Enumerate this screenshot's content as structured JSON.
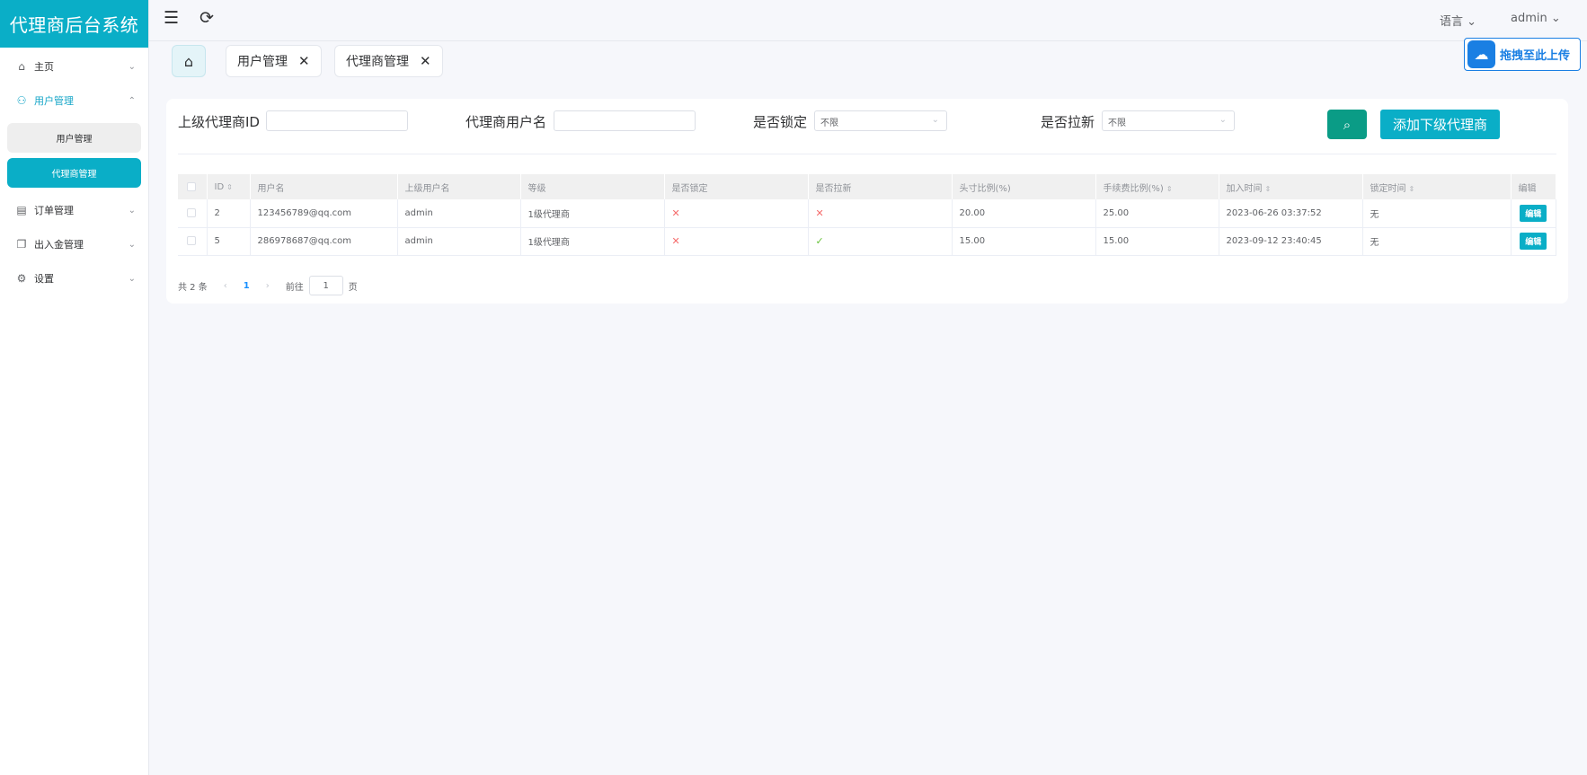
{
  "app": {
    "title": "代理商后台系统"
  },
  "sidebar": {
    "items": [
      {
        "label": "主页",
        "icon": "home-icon",
        "glyph": "⌂",
        "chev": "⌄"
      },
      {
        "label": "用户管理",
        "icon": "user-icon",
        "glyph": "⚇",
        "chev": "⌃"
      },
      {
        "label": "订单管理",
        "icon": "document-icon",
        "glyph": "▤",
        "chev": "⌄"
      },
      {
        "label": "出入金管理",
        "icon": "copy-icon",
        "glyph": "❐",
        "chev": "⌄"
      },
      {
        "label": "设置",
        "icon": "gear-icon",
        "glyph": "⚙",
        "chev": "⌄"
      }
    ],
    "sub_items": [
      "用户管理",
      "代理商管理"
    ]
  },
  "header": {
    "language": "语言 ⌄",
    "user": "admin ⌄",
    "menu_glyph": "☰",
    "refresh_glyph": "⟳"
  },
  "tabs": [
    {
      "label": "用户管理",
      "close": "✕"
    },
    {
      "label": "代理商管理",
      "close": "✕"
    }
  ],
  "home_glyph": "⌂",
  "upload": {
    "label": "拖拽至此上传",
    "glyph": "☁"
  },
  "filters": {
    "parent_id_label": "上级代理商ID",
    "username_label": "代理商用户名",
    "locked_label": "是否锁定",
    "locked_value": "不限",
    "pulled_label": "是否拉新",
    "pulled_value": "不限",
    "search_glyph": "⌕",
    "add_label": "添加下级代理商",
    "arrow": "⌄"
  },
  "table": {
    "columns": [
      "ID",
      "用户名",
      "上级用户名",
      "等级",
      "是否锁定",
      "是否拉新",
      "头寸比例(%)",
      "手续费比例(%)",
      "加入时间",
      "锁定时间",
      "编辑"
    ],
    "sort_glyph": "⇕",
    "rows": [
      {
        "id": "2",
        "username": "123456789@qq.com",
        "parent": "admin",
        "level": "1级代理商",
        "locked": "✕",
        "pulled": "✕",
        "position_ratio": "20.00",
        "fee_ratio": "25.00",
        "join_time": "2023-06-26 03:37:52",
        "lock_time": "无",
        "edit": "编辑"
      },
      {
        "id": "5",
        "username": "286978687@qq.com",
        "parent": "admin",
        "level": "1级代理商",
        "locked": "✕",
        "pulled": "✓",
        "position_ratio": "15.00",
        "fee_ratio": "15.00",
        "join_time": "2023-09-12 23:40:45",
        "lock_time": "无",
        "edit": "编辑"
      }
    ]
  },
  "pagination": {
    "total": "共 2 条",
    "prev": "‹",
    "page": "1",
    "next": "›",
    "goto": "前往",
    "goto_value": "1",
    "page_unit": "页"
  }
}
